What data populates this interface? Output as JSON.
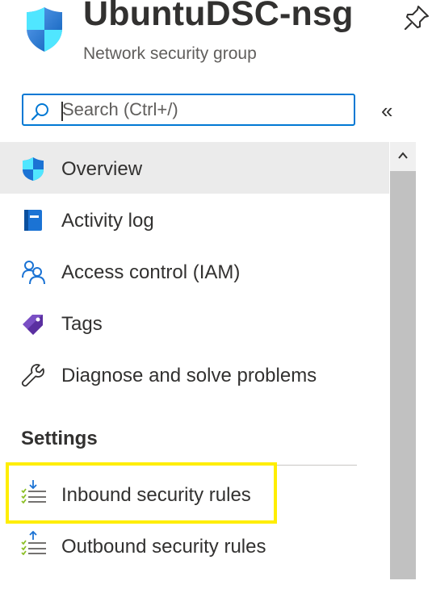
{
  "header": {
    "title": "UbuntuDSC-nsg",
    "subtitle": "Network security group",
    "resource_icon": "nsg-shield-icon",
    "pin_icon": "pin-icon"
  },
  "search": {
    "placeholder": "Search (Ctrl+/)",
    "value": ""
  },
  "collapse_label": "«",
  "nav": {
    "items": [
      {
        "label": "Overview",
        "icon": "shield-icon",
        "selected": true
      },
      {
        "label": "Activity log",
        "icon": "activity-log-icon"
      },
      {
        "label": "Access control (IAM)",
        "icon": "people-icon"
      },
      {
        "label": "Tags",
        "icon": "tag-icon"
      },
      {
        "label": "Diagnose and solve problems",
        "icon": "wrench-icon"
      }
    ]
  },
  "settings": {
    "heading": "Settings",
    "items": [
      {
        "label": "Inbound security rules",
        "icon": "inbound-rules-icon",
        "highlighted": true
      },
      {
        "label": "Outbound security rules",
        "icon": "outbound-rules-icon"
      }
    ]
  },
  "colors": {
    "accent": "#0078d4",
    "highlight": "#ffee00",
    "selected_bg": "#ebebeb"
  }
}
